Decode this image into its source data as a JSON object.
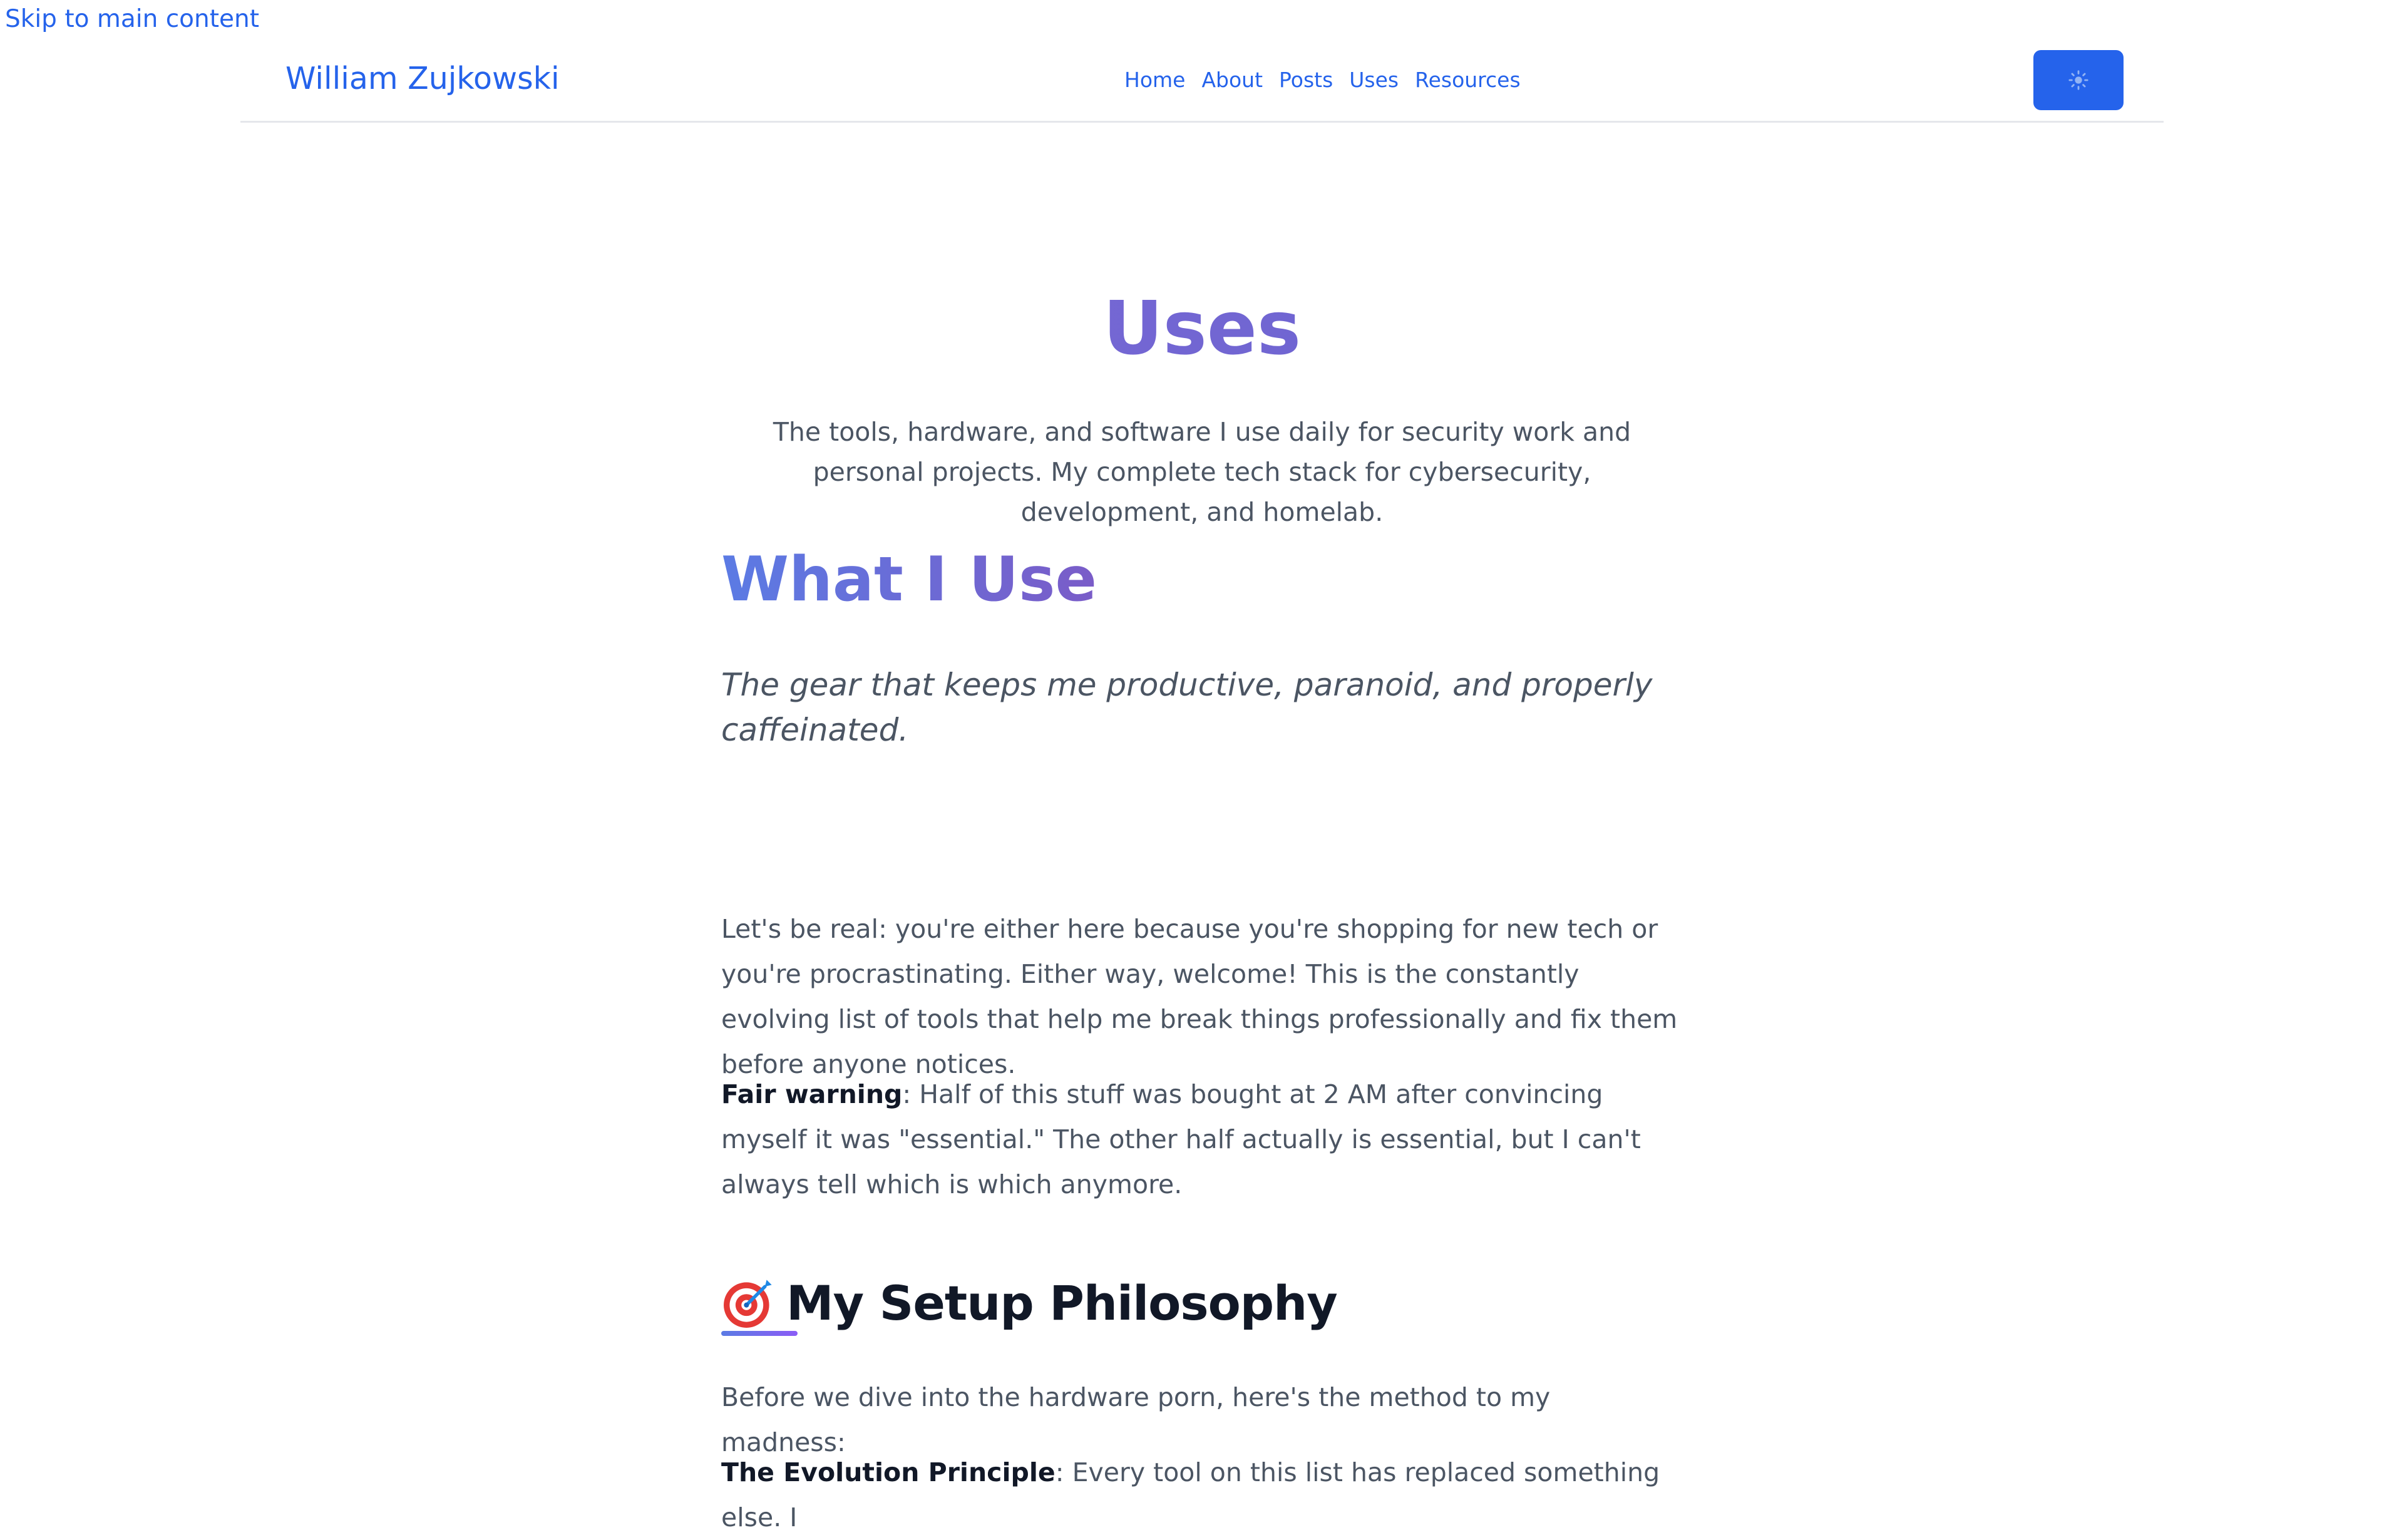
{
  "skip_link": "Skip to main content",
  "header": {
    "brand": "William Zujkowski",
    "nav": [
      {
        "label": "Home"
      },
      {
        "label": "About"
      },
      {
        "label": "Posts"
      },
      {
        "label": "Uses"
      },
      {
        "label": "Resources"
      }
    ],
    "theme_toggle_icon": "sun-icon"
  },
  "colors": {
    "accent": "#2563eb",
    "title_gradient_start": "#7a6ad6",
    "title_gradient_end": "#6a62cf"
  },
  "main": {
    "title": "Uses",
    "description": "The tools, hardware, and software I use daily for security work and personal projects. My complete tech stack for cybersecurity, development, and homelab.",
    "heading": "What I Use",
    "tagline": "The gear that keeps me productive, paranoid, and properly caffeinated.",
    "intro": "Let's be real: you're either here because you're shopping for new tech or you're procrastinating. Either way, welcome! This is the constantly evolving list of tools that help me break things professionally and fix them before anyone notices.",
    "warning_label": "Fair warning",
    "warning_text": ": Half of this stuff was bought at 2 AM after convincing myself it was \"essential.\" The other half actually is essential, but I can't always tell which is which anymore.",
    "section_heading": "My Setup Philosophy",
    "section_icon": "target-icon",
    "section_intro": "Before we dive into the hardware porn, here's the method to my madness:",
    "evolution_label": "The Evolution Principle",
    "evolution_text": ": Every tool on this list has replaced something else. I"
  }
}
